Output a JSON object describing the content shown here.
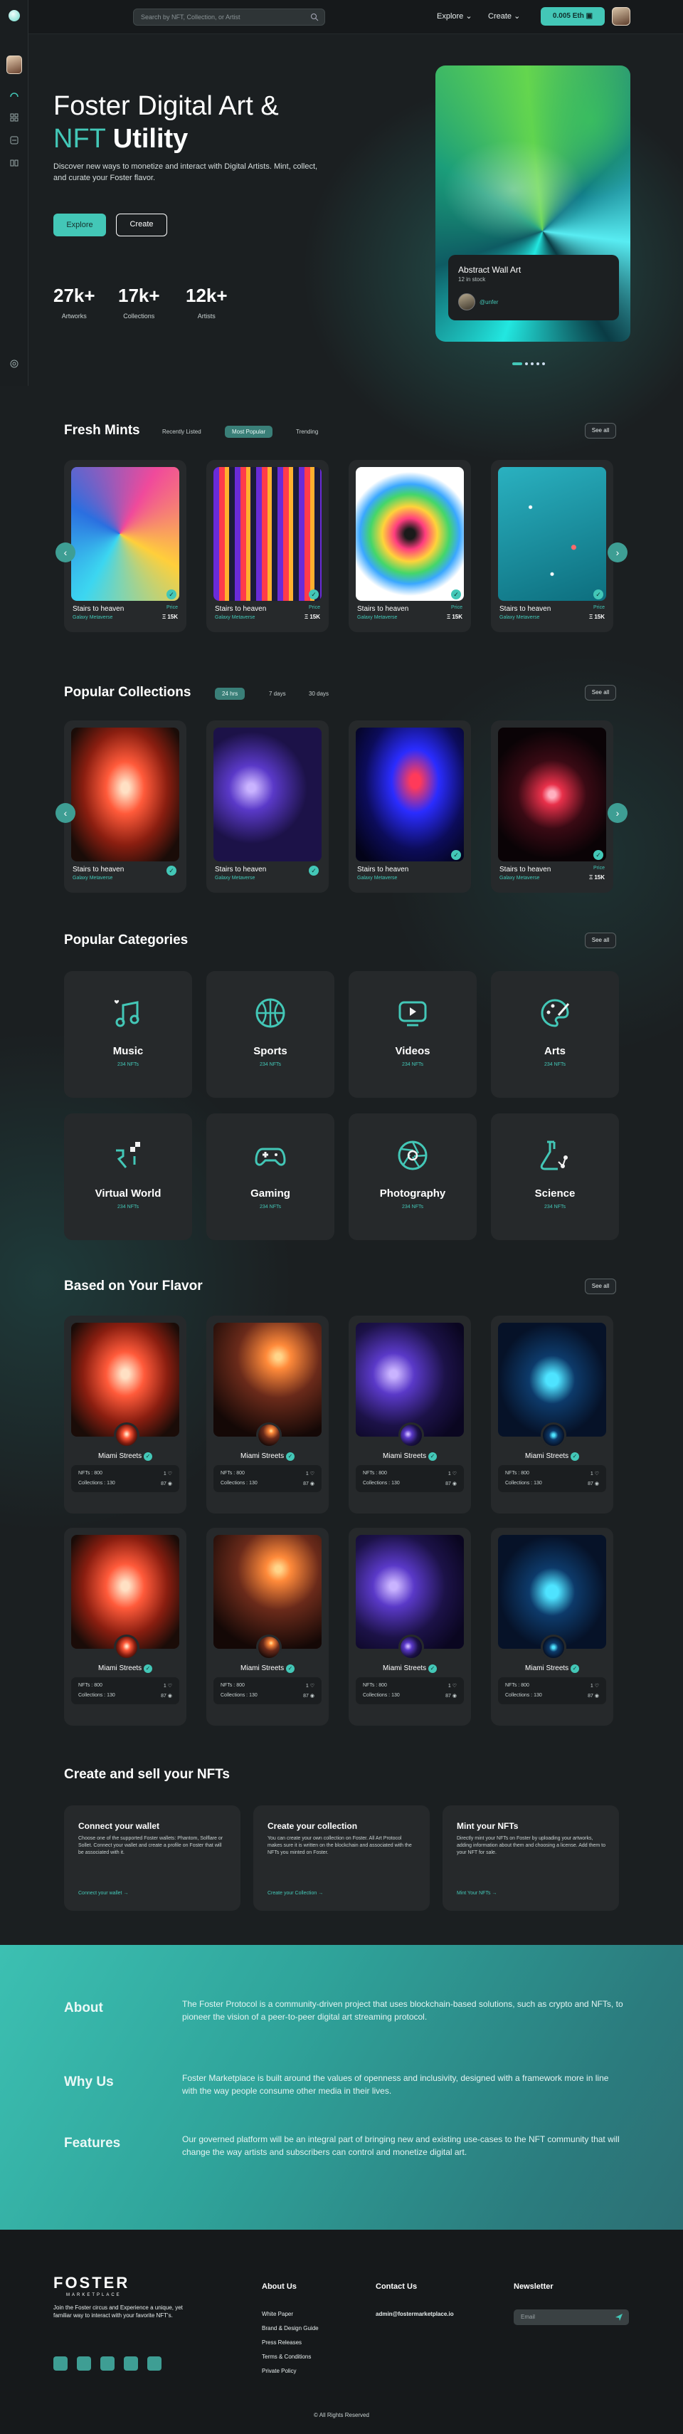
{
  "topbar": {
    "search_placeholder": "Search by NFT, Collection, or Artist",
    "nav": [
      "Explore",
      "Create"
    ],
    "wallet": "0.005 Eth"
  },
  "hero": {
    "title_line1": "Foster Digital Art &",
    "title_nft": "NFT",
    "title_utility": "Utility",
    "desc": "Discover new ways to monetize and interact with  Digital Artists. Mint, collect, and curate your Foster flavor.",
    "explore": "Explore",
    "create": "Create",
    "stats": [
      {
        "n": "27k+",
        "l": "Artworks"
      },
      {
        "n": "17k+",
        "l": "Collections"
      },
      {
        "n": "12k+",
        "l": "Artists"
      }
    ],
    "card": {
      "title": "Abstract Wall Art",
      "stock": "12 in stock",
      "user": "@unfer"
    }
  },
  "fresh": {
    "title": "Fresh Mints",
    "tabs": [
      "Recently Listed",
      "Most Popular",
      "Trending"
    ],
    "see_all": "See all"
  },
  "popular": {
    "title": "Popular Collections",
    "tabs": [
      "24 hrs",
      "7 days",
      "30 days"
    ],
    "see_all": "See all"
  },
  "card_common": {
    "title": "Stairs to heaven",
    "sub": "Galaxy Metaverse",
    "price_label": "Price",
    "price": "15K"
  },
  "categories": {
    "title": "Popular Categories",
    "see_all": "See all",
    "items": [
      {
        "name": "Music",
        "count": "234 NFTs",
        "icon": "music-icon"
      },
      {
        "name": "Sports",
        "count": "234 NFTs",
        "icon": "basketball-icon"
      },
      {
        "name": "Videos",
        "count": "234 NFTs",
        "icon": "video-icon"
      },
      {
        "name": "Arts",
        "count": "234 NFTs",
        "icon": "palette-icon"
      },
      {
        "name": "Virtual World",
        "count": "234 NFTs",
        "icon": "virtual-world-icon"
      },
      {
        "name": "Gaming",
        "count": "234 NFTs",
        "icon": "gamepad-icon"
      },
      {
        "name": "Photography",
        "count": "234 NFTs",
        "icon": "camera-aperture-icon"
      },
      {
        "name": "Science",
        "count": "234 NFTs",
        "icon": "flask-icon"
      }
    ]
  },
  "flavor": {
    "title": "Based on Your Flavor",
    "see_all": "See all",
    "name": "Miami Streets",
    "nfts_label": "NFTs :",
    "nfts": "800",
    "collections_label": "Collections :",
    "collections": "130",
    "likes": "1",
    "views": "87"
  },
  "create_sell": {
    "title": "Create and sell your NFTs",
    "items": [
      {
        "h": "Connect your wallet",
        "p": "Choose one of the supported Foster wallets: Phantom, Solflare or Sollet. Connect your wallet and create a profile on Foster that will be associated with it.",
        "a": "Connect your wallet"
      },
      {
        "h": "Create your collection",
        "p": "You can create your own collection on Foster. All Art Protocol makes sure it is written on the blockchain and associated with the NFTs you minted on Foster.",
        "a": "Create your Collection"
      },
      {
        "h": "Mint your NFTs",
        "p": "Directly mint your NFTs on Foster by uploading your artworks, adding information about them and choosing a license. Add them to your NFT for sale.",
        "a": "Mint Your NFTs"
      }
    ]
  },
  "about": [
    {
      "k": "About",
      "v": "The Foster Protocol is a community-driven project that uses blockchain-based solutions, such as crypto and NFTs, to pioneer the vision of a peer-to-peer digital art streaming protocol."
    },
    {
      "k": "Why Us",
      "v": "Foster Marketplace is built around the values of openness and inclusivity, designed with a framework more in line with the way people consume other media in their lives."
    },
    {
      "k": "Features",
      "v": "Our governed platform will be an integral part of bringing new and existing use-cases to the NFT community that will change the way artists and subscribers can control and monetize digital art."
    }
  ],
  "footer": {
    "brand": "FOSTER",
    "brand_sub": "MARKETPLACE",
    "tagline": "Join the Foster circus and Experience a unique, yet familiar way to interact with your favorite NFT's.",
    "about_h": "About Us",
    "links": [
      "White Paper",
      "Brand & Design Guide",
      "Press Releases",
      "Terms & Conditions",
      "Private Policy"
    ],
    "contact_h": "Contact Us",
    "email": "admin@fostermarketplace.io",
    "newsletter_h": "Newsletter",
    "email_ph": "Email",
    "copyright": "© All Rights Reserved"
  },
  "colors": {
    "accent": "#43c7b7",
    "bg": "#1b1f21",
    "card": "#26292b"
  }
}
